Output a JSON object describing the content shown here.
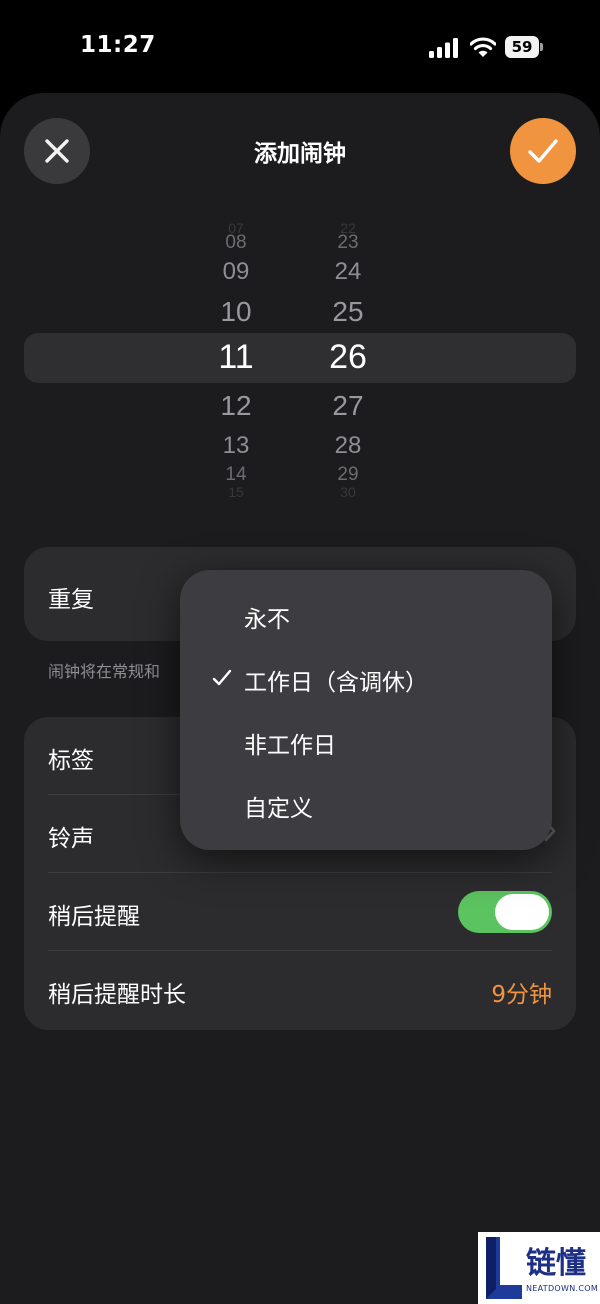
{
  "status_bar": {
    "time": "11:27",
    "battery": "59"
  },
  "header": {
    "title": "添加闹钟",
    "close_icon": "close-icon",
    "confirm_icon": "checkmark-icon",
    "accent_color": "#f0943f"
  },
  "picker": {
    "hours": [
      "07",
      "08",
      "09",
      "10",
      "11",
      "12",
      "13",
      "14",
      "15"
    ],
    "minutes": [
      "22",
      "23",
      "24",
      "25",
      "26",
      "27",
      "28",
      "29",
      "30"
    ],
    "selected_hour": "11",
    "selected_minute": "26"
  },
  "repeat": {
    "label": "重复",
    "note": "闹钟将在常规和"
  },
  "settings": {
    "label_row": "标签",
    "ringtone_row": "铃声",
    "snooze_row": "稍后提醒",
    "snooze_enabled": true,
    "snooze_duration_row": "稍后提醒时长",
    "snooze_duration_value": "9分钟",
    "toggle_color": "#5bc35f"
  },
  "dropdown": {
    "options": [
      {
        "label": "永不",
        "checked": false
      },
      {
        "label": "工作日（含调休）",
        "checked": true
      },
      {
        "label": "非工作日",
        "checked": false
      },
      {
        "label": "自定义",
        "checked": false
      }
    ]
  },
  "watermark": {
    "name": "链懂",
    "site": "NEATDOWN.COM"
  }
}
